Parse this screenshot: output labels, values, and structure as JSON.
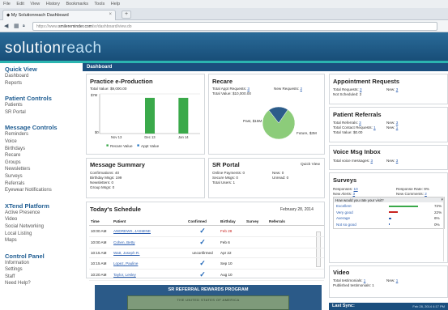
{
  "browser": {
    "menu": [
      "File",
      "Edit",
      "View",
      "History",
      "Bookmarks",
      "Tools",
      "Help"
    ],
    "tab_title": "My Solutionreach Dashboard",
    "tab_close": "×",
    "new_tab": "+",
    "url_prefix": "https://www.",
    "url_host": "smilereminder.com",
    "url_path": "/sr/dashboard/view.do"
  },
  "brand": {
    "logo_part1": "solution",
    "logo_part2": "reach",
    "accent": "#2bb5b0",
    "header_bg": "#1b4f7e"
  },
  "dashboard_title": "Dashboard",
  "sidebar": {
    "quick_view": "Quick View",
    "quick_links": [
      "Dashboard",
      "Reports"
    ],
    "patient_controls": "Patient Controls",
    "patient_links": [
      "Patients",
      "SR Portal"
    ],
    "message_controls": "Message Controls",
    "message_links": [
      "Reminders",
      "Voice",
      "Birthdays",
      "Recare",
      "Groups",
      "Newsletters",
      "Surveys",
      "Referrals",
      "Eyewear Notifications"
    ],
    "xtend": "XTend Platform",
    "xtend_links": [
      "Active Presence",
      "Video",
      "Social Networking",
      "Local Listing",
      "Maps"
    ],
    "control_panel": "Control Panel",
    "control_links": [
      "Information",
      "Settings",
      "Staff",
      "Need Help?"
    ]
  },
  "practice": {
    "title": "Practice e-Production",
    "total": "Total Value: $9,000.00",
    "ylabel_top": "$7M",
    "ylabel_bottom": "$0",
    "legend1": "Recare Value",
    "legend2": "Appt Value"
  },
  "chart_data": [
    {
      "type": "bar",
      "title": "Practice e-Production",
      "categories": [
        "Nov 13",
        "Dec 13",
        "Jan 14"
      ],
      "series": [
        {
          "name": "Recare Value",
          "values": [
            0,
            6.3,
            6.3
          ]
        },
        {
          "name": "Appt Value",
          "values": [
            0,
            0,
            0
          ]
        }
      ],
      "ylim": [
        0,
        7
      ],
      "colors": [
        "#3aa94a",
        "#2a7bc8"
      ]
    },
    {
      "type": "pie",
      "title": "Recare",
      "categories": [
        "Past",
        "Future"
      ],
      "values": [
        80,
        20
      ],
      "labels": [
        "Past, $15M",
        "Future, $3M"
      ],
      "colors": [
        "#8ccc7a",
        "#2c5c8a"
      ]
    }
  ],
  "recare": {
    "title": "Recare",
    "appt_requests_label": "Total Appt Requests:",
    "appt_requests_val": "3",
    "new_requests_label": "New Requests:",
    "new_requests_val": "2",
    "total_value": "Total Value: $10,000.00",
    "past_label": "Past, $15M",
    "future_label": "Future, $3M"
  },
  "appt": {
    "title": "Appointment Requests",
    "total_label": "Total Requests:",
    "total_val": "3",
    "new_label": "New:",
    "new_val": "3",
    "not_scheduled": "Not Scheduled: 2"
  },
  "referrals": {
    "title": "Patient Referrals",
    "total_label": "Total Referrals:",
    "total_val": "3",
    "new_label": "New:",
    "new_val": "3",
    "contact_label": "Total Contact Requests:",
    "contact_val": "1",
    "contact_new_label": "New:",
    "contact_new_val": "1",
    "value": "Total Value: $0.00"
  },
  "voice": {
    "title": "Voice Msg Inbox",
    "total_label": "Total voice messages:",
    "total_val": "3",
    "new_label": "New:",
    "new_val": "3"
  },
  "surveys": {
    "title": "Surveys",
    "responses_label": "Responses:",
    "responses_val": "10",
    "rate": "Response Rate: 9%",
    "alerts_label": "New Alerts:",
    "alerts_val": "3",
    "comments_label": "New Comments:",
    "comments_val": "2",
    "question": "How would you rate your visit?",
    "rows": [
      {
        "label": "Excellent",
        "pct": "72%",
        "frac": 0.72,
        "color": "#3aa94a"
      },
      {
        "label": "Very good",
        "pct": "22%",
        "frac": 0.22,
        "color": "#c8231f"
      },
      {
        "label": "Average",
        "pct": "6%",
        "frac": 0.06,
        "color": "#2a5db0"
      },
      {
        "label": "Not so good",
        "pct": "0%",
        "frac": 0.0,
        "color": "#2a5db0"
      }
    ]
  },
  "message_summary": {
    "title": "Message Summary",
    "lines": [
      "Confirmations: 40",
      "Birthday Msgs: 199",
      "Newsletters: 0",
      "Group Msgs: 0"
    ]
  },
  "portal": {
    "title": "SR Portal",
    "quick_view": "Quick View",
    "lines": [
      "Online Payments: 0",
      "Secure Msgs: 0",
      "Total Users: 1"
    ],
    "new_label": "New: 0",
    "unread_label": "Unread: 0"
  },
  "schedule": {
    "title": "Today's Schedule",
    "date": "February 28, 2014",
    "headers": [
      "Time",
      "Patient",
      "Confirmed",
      "Birthday",
      "Survey",
      "Referrals"
    ],
    "rows": [
      {
        "time": "10:00 AM",
        "patient": "ANDREWS, JASMINE",
        "confirmed": "✓",
        "birthday": "Feb 28"
      },
      {
        "time": "10:00 AM",
        "patient": "Cohen, Betty",
        "confirmed": "✓",
        "birthday": "Feb 6"
      },
      {
        "time": "10:15 AM",
        "patient": "Watt, Joseph R.",
        "confirmed": "unconfirmed",
        "birthday": "Apr 22"
      },
      {
        "time": "10:15 AM",
        "patient": "Lopez, Pauline",
        "confirmed": "✓",
        "birthday": "Sep 10"
      },
      {
        "time": "10:20 AM",
        "patient": "Taylor, Lesley",
        "confirmed": "✓",
        "birthday": "Aug 10"
      }
    ]
  },
  "video": {
    "title": "Video",
    "total_label": "Total testimonials:",
    "total_val": "1",
    "new_label": "New:",
    "new_val": "1",
    "published": "Published testimonials: 1"
  },
  "banner": {
    "title": "SR REFERRAL REWARDS PROGRAM",
    "bill": "THE UNITED STATES OF AMERICA"
  },
  "last_sync": {
    "label": "Last Sync:",
    "value": "Feb 28, 2014 4:17 PM"
  }
}
